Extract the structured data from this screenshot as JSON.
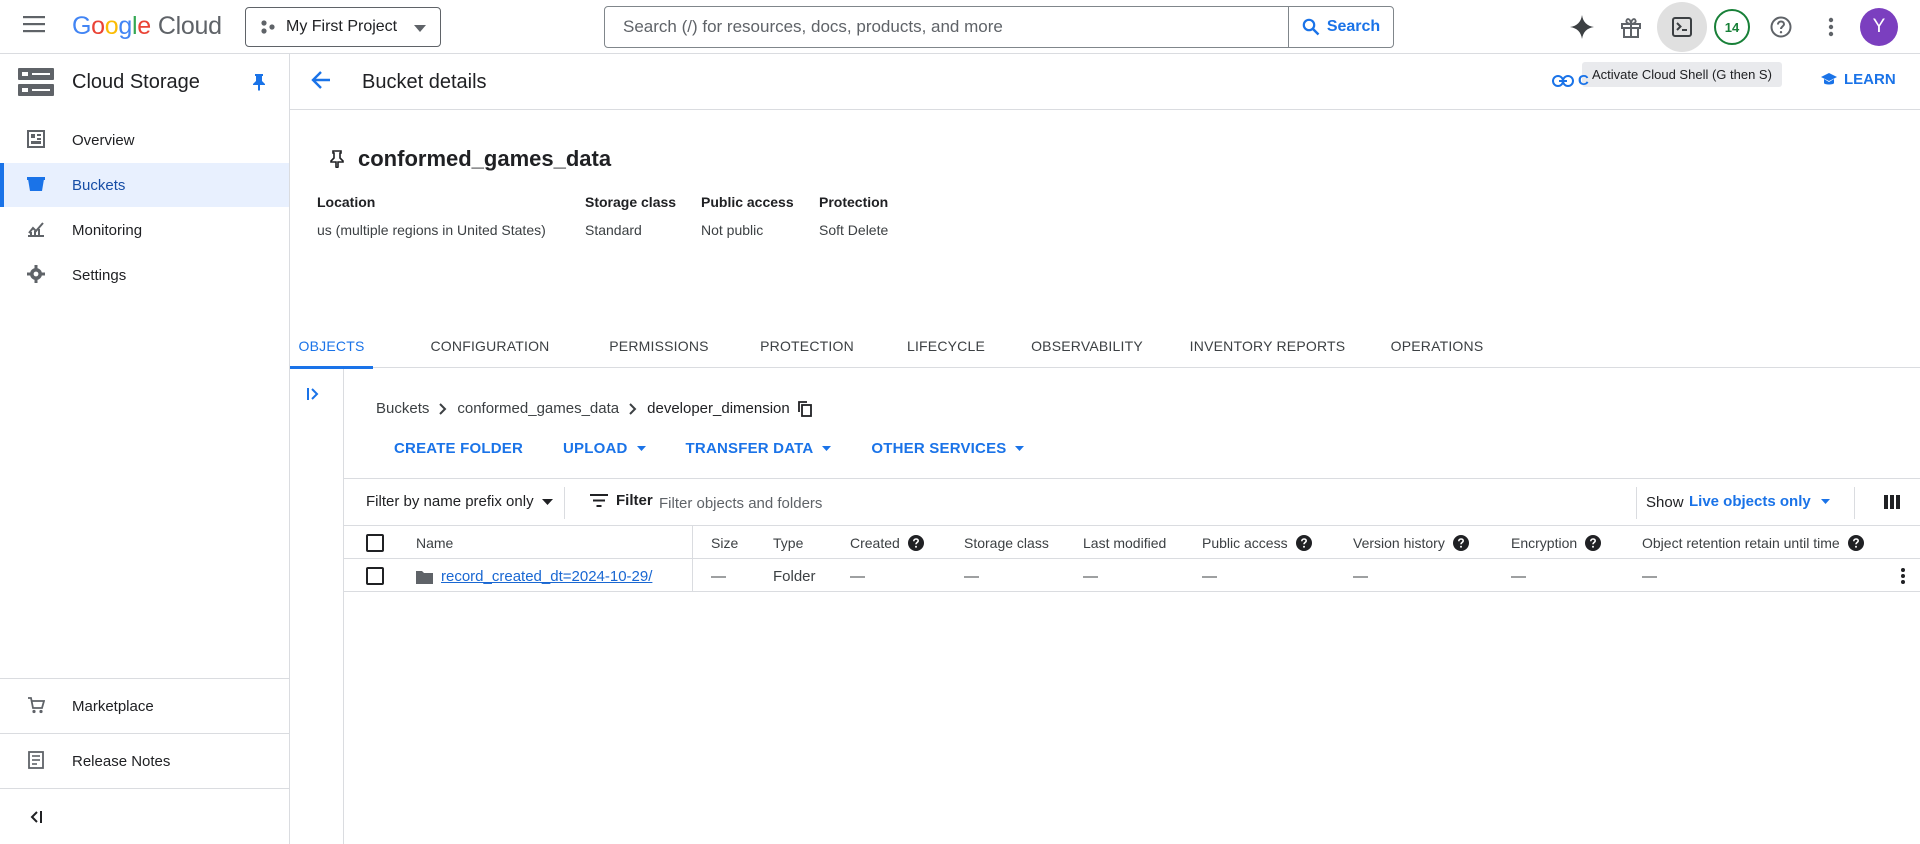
{
  "header": {
    "logo_google": "Google",
    "logo_cloud": "Cloud",
    "project_name": "My First Project",
    "search_placeholder": "Search (/) for resources, docs, products, and more",
    "search_button": "Search",
    "notification_count": "14",
    "avatar_letter": "Y",
    "tooltip": "Activate Cloud Shell (G then S)"
  },
  "sidebar": {
    "product_title": "Cloud Storage",
    "items": [
      {
        "label": "Overview",
        "icon": "dashboard-icon"
      },
      {
        "label": "Buckets",
        "icon": "bucket-icon",
        "selected": true
      },
      {
        "label": "Monitoring",
        "icon": "monitoring-icon"
      },
      {
        "label": "Settings",
        "icon": "gear-icon"
      }
    ],
    "footer_items": [
      {
        "label": "Marketplace",
        "icon": "cart-icon"
      },
      {
        "label": "Release Notes",
        "icon": "release-notes-icon"
      }
    ]
  },
  "page": {
    "title": "Bucket details",
    "head_link_label": "C",
    "learn_label": "LEARN",
    "bucket_name": "conformed_games_data",
    "meta": [
      {
        "key": "Location",
        "value": "us (multiple regions in United States)"
      },
      {
        "key": "Storage class",
        "value": "Standard"
      },
      {
        "key": "Public access",
        "value": "Not public"
      },
      {
        "key": "Protection",
        "value": "Soft Delete"
      }
    ],
    "tabs": [
      "OBJECTS",
      "CONFIGURATION",
      "PERMISSIONS",
      "PROTECTION",
      "LIFECYCLE",
      "OBSERVABILITY",
      "INVENTORY REPORTS",
      "OPERATIONS"
    ],
    "active_tab": "OBJECTS",
    "breadcrumb": [
      "Buckets",
      "conformed_games_data",
      "developer_dimension"
    ],
    "actions": [
      "CREATE FOLDER",
      "UPLOAD",
      "TRANSFER DATA",
      "OTHER SERVICES"
    ]
  },
  "filterbar": {
    "prefix_filter": "Filter by name prefix only",
    "filter_label": "Filter",
    "filter_placeholder": "Filter objects and folders",
    "show_label": "Show",
    "show_value": "Live objects only"
  },
  "table": {
    "columns": [
      "Name",
      "Size",
      "Type",
      "Created",
      "Storage class",
      "Last modified",
      "Public access",
      "Version history",
      "Encryption",
      "Object retention retain until time"
    ],
    "rows": [
      {
        "name": "record_created_dt=2024-10-29/",
        "size": "—",
        "type": "Folder",
        "created": "—",
        "storage_class": "—",
        "last_modified": "—",
        "public_access": "—",
        "version_history": "—",
        "encryption": "—",
        "retention": "—"
      }
    ]
  },
  "colors": {
    "accent": "#1a73e8",
    "selected_bg": "#e8f0fe",
    "notification": "#188038",
    "avatar": "#7b3fbf"
  }
}
